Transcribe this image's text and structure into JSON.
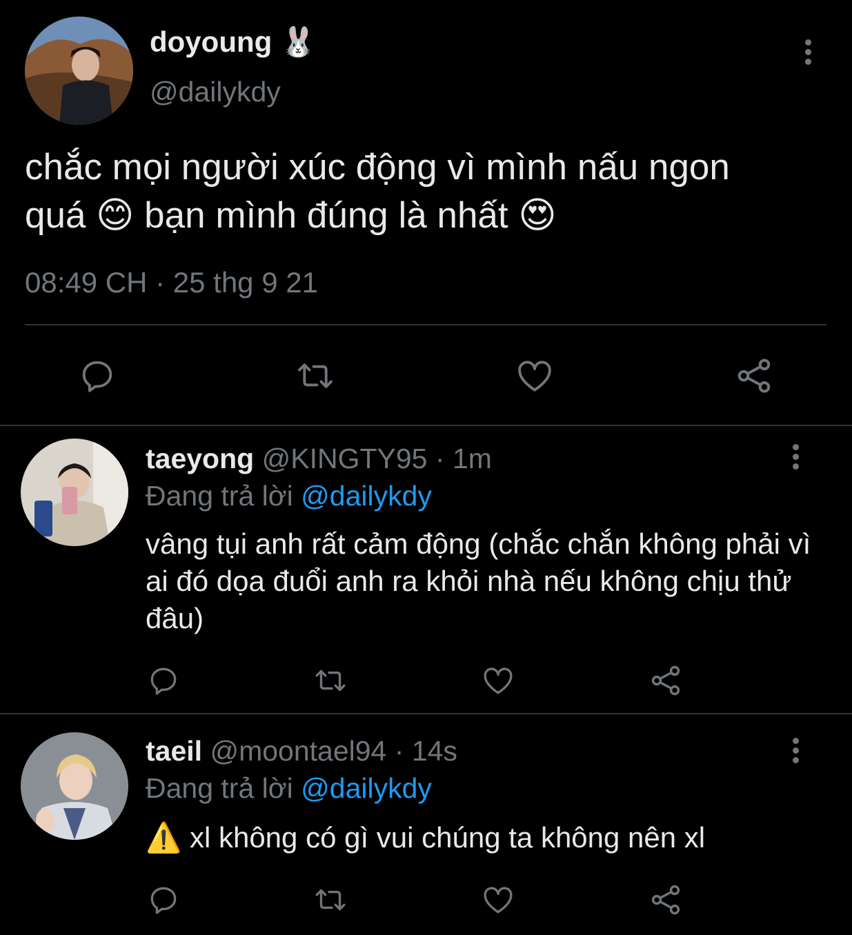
{
  "main_tweet": {
    "display_name": "doyoung",
    "name_emoji": "🐰",
    "handle": "@dailykdy",
    "text_line1": "chắc mọi người xúc động vì mình nấu ngon",
    "text_line2_a": "quá",
    "emoji_1": "😊",
    "text_line2_b": "bạn mình đúng là nhất",
    "emoji_2": "😍",
    "timestamp": "08:49 CH · 25 thg 9 21",
    "actions": [
      "reply-icon",
      "retweet-icon",
      "like-icon",
      "share-icon"
    ]
  },
  "replies": [
    {
      "display_name": "taeyong",
      "handle": "@KINGTY95",
      "dot": "·",
      "time": "1m",
      "replying_prefix": "Đang trả lời",
      "replying_mention": "@dailykdy",
      "text": "vâng tụi anh rất cảm động (chắc chắn không phải vì ai đó dọa đuổi anh ra khỏi nhà nếu không chịu thử đâu)"
    },
    {
      "display_name": "taeil",
      "handle": "@moontael94",
      "dot": "·",
      "time": "14s",
      "replying_prefix": "Đang trả lời",
      "replying_mention": "@dailykdy",
      "warning_emoji": "⚠️",
      "text": "xl không có gì vui chúng ta không nên xl"
    }
  ],
  "colors": {
    "background": "#000000",
    "primary_text": "#e7e9ea",
    "secondary_text": "#71767b",
    "accent": "#1d9bf0",
    "divider": "#2f3336"
  }
}
